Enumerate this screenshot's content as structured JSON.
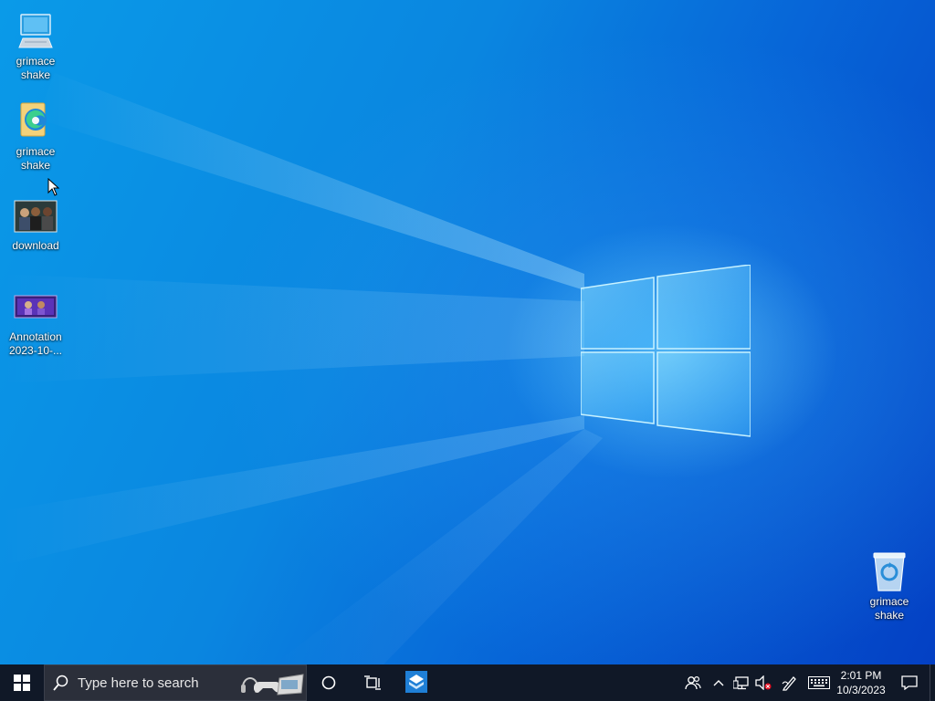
{
  "desktop": {
    "icons": [
      {
        "label": "grimace shake",
        "icon": "computer-icon"
      },
      {
        "label": "grimace shake",
        "icon": "edge-shortcut-icon"
      },
      {
        "label": "download",
        "icon": "image-thumbnail-icon"
      },
      {
        "label": "Annotation 2023-10-...",
        "icon": "image-thumbnail-icon"
      },
      {
        "label": "grimace shake",
        "icon": "recycle-bin-icon"
      }
    ]
  },
  "taskbar": {
    "search_placeholder": "Type here to search",
    "clock": {
      "time": "2:01 PM",
      "date": "10/3/2023"
    },
    "tray_icons": [
      "people-icon",
      "chevron-up-icon",
      "network-icon",
      "volume-muted-icon",
      "pen-icon",
      "keyboard-icon",
      "notification-icon"
    ]
  },
  "colors": {
    "taskbar": "#101827",
    "accent": "#0a86e0"
  }
}
